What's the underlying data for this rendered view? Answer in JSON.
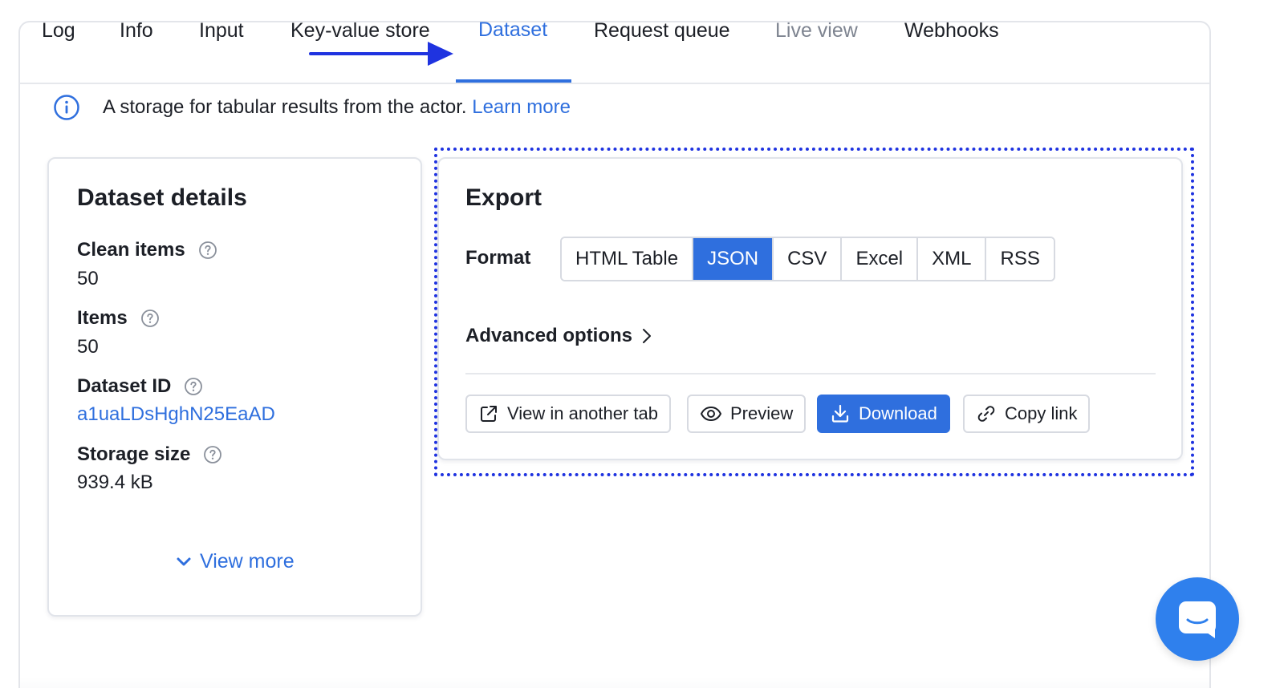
{
  "tabs": [
    {
      "label": "Log",
      "state": "normal"
    },
    {
      "label": "Info",
      "state": "normal"
    },
    {
      "label": "Input",
      "state": "normal"
    },
    {
      "label": "Key-value store",
      "state": "normal"
    },
    {
      "label": "Dataset",
      "state": "active"
    },
    {
      "label": "Request queue",
      "state": "normal"
    },
    {
      "label": "Live view",
      "state": "disabled"
    },
    {
      "label": "Webhooks",
      "state": "normal"
    }
  ],
  "info": {
    "text": "A storage for tabular results from the actor.",
    "link": "Learn more"
  },
  "details": {
    "title": "Dataset details",
    "fields": [
      {
        "label": "Clean items",
        "value": "50"
      },
      {
        "label": "Items",
        "value": "50"
      },
      {
        "label": "Dataset ID",
        "value": "a1uaLDsHghN25EaAD"
      },
      {
        "label": "Storage size",
        "value": "939.4 kB"
      }
    ],
    "view_more": "View more"
  },
  "export": {
    "title": "Export",
    "format_label": "Format",
    "formats": [
      "HTML Table",
      "JSON",
      "CSV",
      "Excel",
      "XML",
      "RSS"
    ],
    "selected_format": "JSON",
    "advanced_options": "Advanced options",
    "actions": {
      "view_in_tab": "View in another tab",
      "preview": "Preview",
      "download": "Download",
      "copy_link": "Copy link"
    }
  },
  "colors": {
    "accent": "#2f6fde",
    "annotation": "#1f33e0",
    "chat": "#2f80ed"
  }
}
